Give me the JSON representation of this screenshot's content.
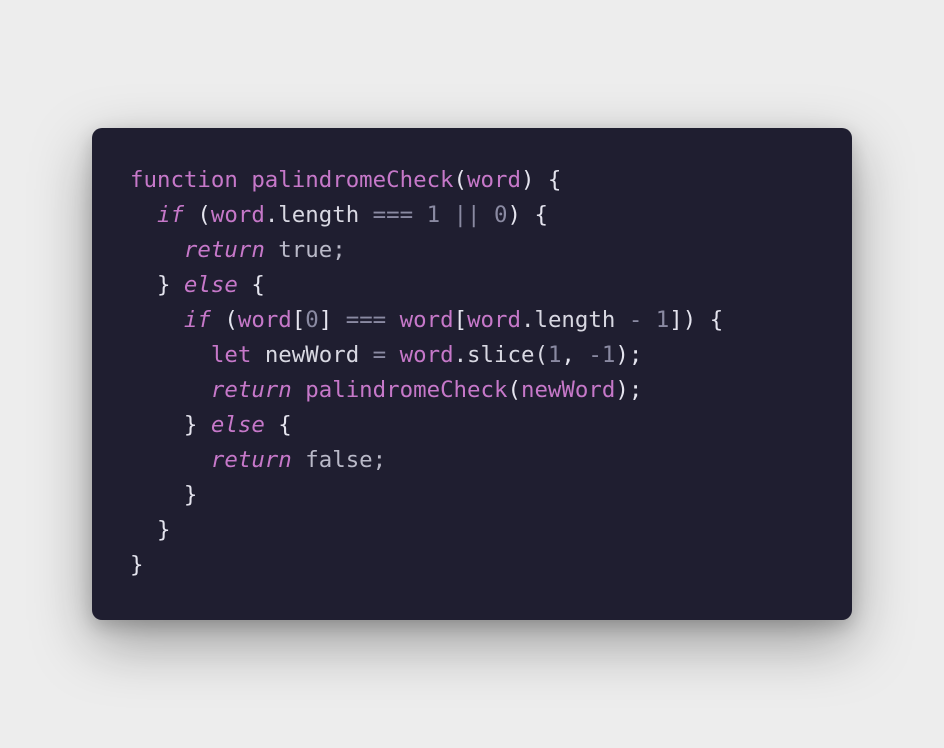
{
  "colors": {
    "background": "#ededed",
    "card": "#1f1e30",
    "keyword": "#c678c9",
    "number": "#8a8aa2",
    "text": "#d8d8e2"
  },
  "code_lines": [
    [
      {
        "t": "function",
        "k": "kw"
      },
      {
        "t": " ",
        "k": "plain"
      },
      {
        "t": "palindromeCheck",
        "k": "fn"
      },
      {
        "t": "(",
        "k": "punc"
      },
      {
        "t": "word",
        "k": "var"
      },
      {
        "t": ") {",
        "k": "punc"
      }
    ],
    [
      {
        "t": "  ",
        "k": "plain"
      },
      {
        "t": "if",
        "k": "ital"
      },
      {
        "t": " (",
        "k": "punc"
      },
      {
        "t": "word",
        "k": "var"
      },
      {
        "t": ".length ",
        "k": "plain"
      },
      {
        "t": "===",
        "k": "op"
      },
      {
        "t": " ",
        "k": "plain"
      },
      {
        "t": "1",
        "k": "num"
      },
      {
        "t": " ",
        "k": "plain"
      },
      {
        "t": "||",
        "k": "op"
      },
      {
        "t": " ",
        "k": "plain"
      },
      {
        "t": "0",
        "k": "num"
      },
      {
        "t": ") {",
        "k": "punc"
      }
    ],
    [
      {
        "t": "    ",
        "k": "plain"
      },
      {
        "t": "return",
        "k": "ital"
      },
      {
        "t": " true;",
        "k": "muted"
      }
    ],
    [
      {
        "t": "  } ",
        "k": "punc"
      },
      {
        "t": "else",
        "k": "ital"
      },
      {
        "t": " {",
        "k": "punc"
      }
    ],
    [
      {
        "t": "    ",
        "k": "plain"
      },
      {
        "t": "if",
        "k": "ital"
      },
      {
        "t": " (",
        "k": "punc"
      },
      {
        "t": "word",
        "k": "var"
      },
      {
        "t": "[",
        "k": "punc"
      },
      {
        "t": "0",
        "k": "num"
      },
      {
        "t": "] ",
        "k": "punc"
      },
      {
        "t": "===",
        "k": "op"
      },
      {
        "t": " ",
        "k": "plain"
      },
      {
        "t": "word",
        "k": "var"
      },
      {
        "t": "[",
        "k": "punc"
      },
      {
        "t": "word",
        "k": "var"
      },
      {
        "t": ".length ",
        "k": "plain"
      },
      {
        "t": "-",
        "k": "op"
      },
      {
        "t": " ",
        "k": "plain"
      },
      {
        "t": "1",
        "k": "num"
      },
      {
        "t": "]) {",
        "k": "punc"
      }
    ],
    [
      {
        "t": "      ",
        "k": "plain"
      },
      {
        "t": "let",
        "k": "kw"
      },
      {
        "t": " newWord ",
        "k": "plain"
      },
      {
        "t": "=",
        "k": "op"
      },
      {
        "t": " ",
        "k": "plain"
      },
      {
        "t": "word",
        "k": "var"
      },
      {
        "t": ".slice(",
        "k": "plain"
      },
      {
        "t": "1",
        "k": "num"
      },
      {
        "t": ", ",
        "k": "punc"
      },
      {
        "t": "-1",
        "k": "num"
      },
      {
        "t": ");",
        "k": "punc"
      }
    ],
    [
      {
        "t": "      ",
        "k": "plain"
      },
      {
        "t": "return",
        "k": "ital"
      },
      {
        "t": " ",
        "k": "plain"
      },
      {
        "t": "palindromeCheck",
        "k": "fn"
      },
      {
        "t": "(",
        "k": "punc"
      },
      {
        "t": "newWord",
        "k": "var"
      },
      {
        "t": ");",
        "k": "punc"
      }
    ],
    [
      {
        "t": "    } ",
        "k": "punc"
      },
      {
        "t": "else",
        "k": "ital"
      },
      {
        "t": " {",
        "k": "punc"
      }
    ],
    [
      {
        "t": "      ",
        "k": "plain"
      },
      {
        "t": "return",
        "k": "ital"
      },
      {
        "t": " false;",
        "k": "muted"
      }
    ],
    [
      {
        "t": "    }",
        "k": "punc"
      }
    ],
    [
      {
        "t": "  }",
        "k": "punc"
      }
    ],
    [
      {
        "t": "}",
        "k": "punc"
      }
    ]
  ]
}
